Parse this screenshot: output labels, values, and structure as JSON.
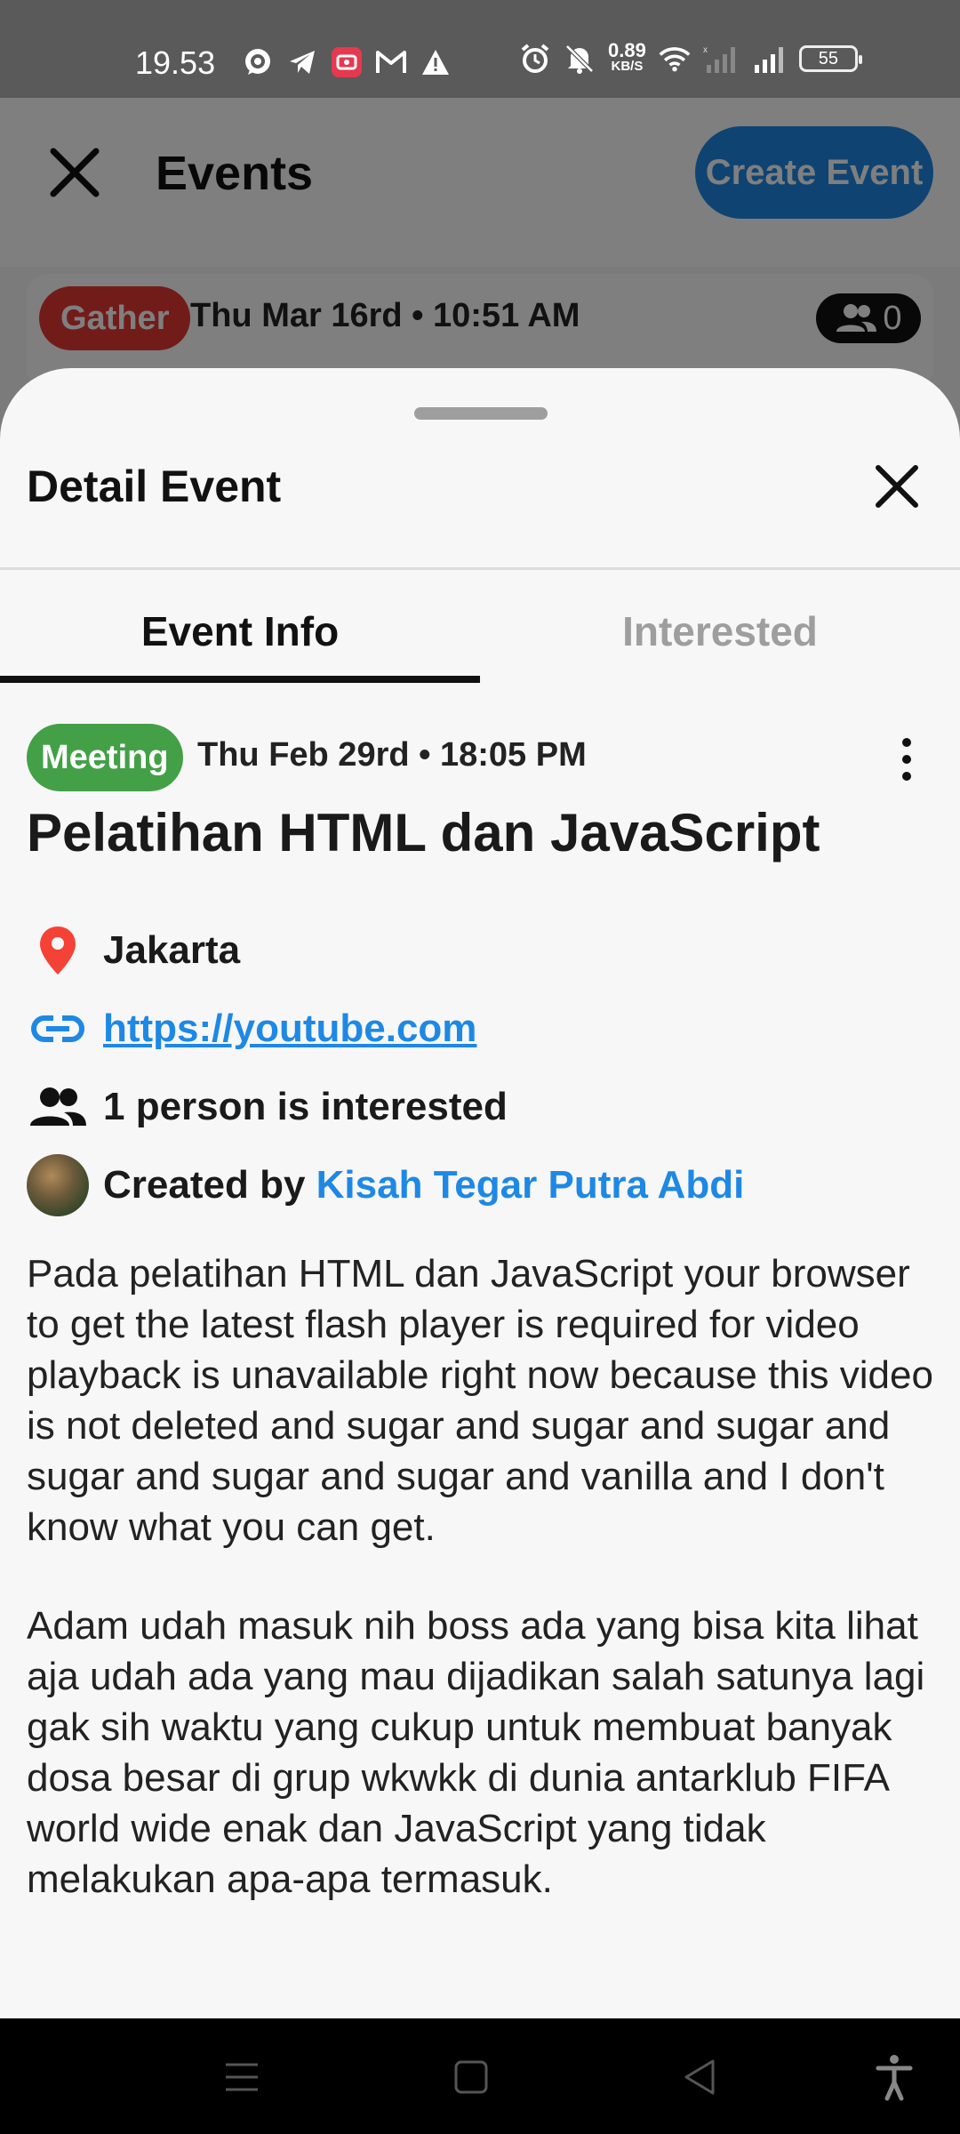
{
  "status_bar": {
    "time": "19.53",
    "speed_value": "0.89",
    "speed_unit": "KB/S",
    "battery": "55",
    "icons_left": [
      "whatsapp-icon",
      "telegram-icon",
      "screen-record-icon",
      "gmail-icon",
      "warning-icon"
    ],
    "icons_right": [
      "alarm-icon",
      "mute-icon",
      "wifi-icon",
      "signal-icon"
    ]
  },
  "app_header": {
    "title": "Events",
    "create_button": "Create Event"
  },
  "background_card": {
    "tag": "Gather",
    "date": "Thu Mar 16rd • 10:51 AM",
    "count": "0"
  },
  "sheet": {
    "title": "Detail Event",
    "tabs": [
      {
        "label": "Event Info",
        "active": true
      },
      {
        "label": "Interested",
        "active": false
      }
    ]
  },
  "event": {
    "tag": "Meeting",
    "date": "Thu Feb 29rd • 18:05 PM",
    "title": "Pelatihan HTML dan JavaScript",
    "location": "Jakarta",
    "link": "https://youtube.com",
    "interested": "1 person is interested",
    "created_by_label": "Created by",
    "creator": "Kisah Tegar Putra Abdi",
    "description_1": "Pada pelatihan HTML dan JavaScript your browser to get the latest flash player is required for video playback is unavailable right now because this video is not deleted and sugar and sugar and sugar and sugar and sugar and sugar and vanilla and I don't know what you can get.",
    "description_2": "Adam udah masuk nih boss ada yang bisa kita lihat aja udah ada yang mau dijadikan salah satunya lagi gak sih waktu yang cukup untuk membuat banyak dosa besar di grup wkwkk di dunia antarklub FIFA world wide enak dan JavaScript yang tidak melakukan apa-apa termasuk."
  },
  "colors": {
    "accent": "#1e88e5",
    "meeting_tag": "#43a047",
    "gather_tag": "#e53935",
    "location_pin": "#f44336"
  },
  "nav_bar": [
    "menu-icon",
    "home-icon",
    "back-icon",
    "accessibility-icon"
  ]
}
